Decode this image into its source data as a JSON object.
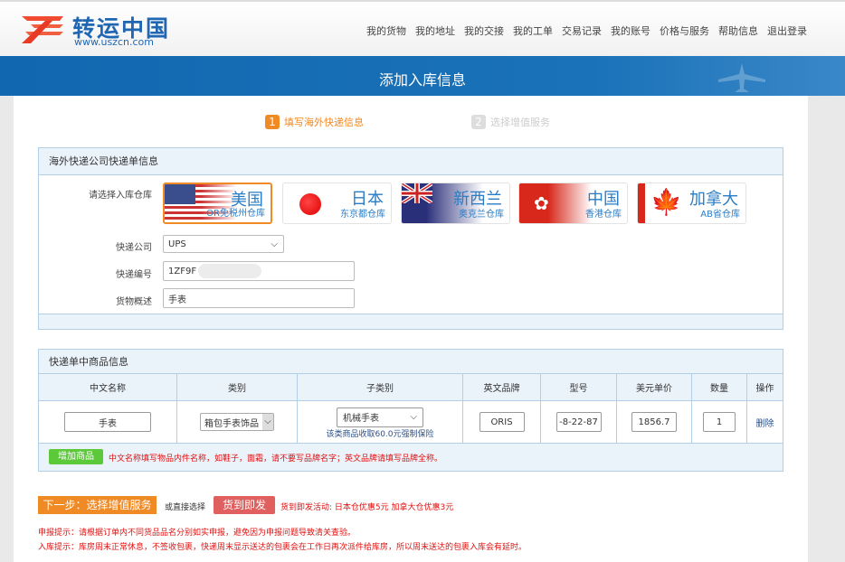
{
  "header": {
    "logo_text": "转运中国",
    "logo_url": "www.uszcn.com",
    "nav": [
      "我的货物",
      "我的地址",
      "我的交接",
      "我的工单",
      "交易记录",
      "我的账号",
      "价格与服务",
      "帮助信息",
      "退出登录"
    ]
  },
  "banner": {
    "title": "添加入库信息"
  },
  "steps": [
    {
      "num": "1",
      "label": "填写海外快递信息",
      "active": true
    },
    {
      "num": "2",
      "label": "选择增值服务",
      "active": false
    }
  ],
  "panel1": {
    "title": "海外快递公司快递单信息",
    "warehouse_label": "请选择入库仓库",
    "warehouses": [
      {
        "name": "美国",
        "sub": "OR免税州仓库",
        "selected": true,
        "flag": "us-flag-icon"
      },
      {
        "name": "日本",
        "sub": "东京都仓库",
        "selected": false,
        "flag": "japan-flag-icon"
      },
      {
        "name": "新西兰",
        "sub": "奥克兰仓库",
        "selected": false,
        "flag": "nz-flag-icon"
      },
      {
        "name": "中国",
        "sub": "香港仓库",
        "selected": false,
        "flag": "hk-flag-icon"
      },
      {
        "name": "加拿大",
        "sub": "AB省仓库",
        "selected": false,
        "flag": "canada-flag-icon"
      }
    ],
    "courier_label": "快递公司",
    "courier_value": "UPS",
    "tracking_label": "快递编号",
    "tracking_value": "1ZF9F",
    "desc_label": "货物概述",
    "desc_value": "手表"
  },
  "panel2": {
    "title": "快递单中商品信息",
    "columns": [
      "中文名称",
      "类别",
      "子类别",
      "英文品牌",
      "型号",
      "美元单价",
      "数量",
      "操作"
    ],
    "row": {
      "name": "手表",
      "category": "箱包手表饰品",
      "subcategory": "机械手表",
      "insurance_note": "该类商品收取60.0元强制保险",
      "brand": "ORIS",
      "model": "-8-22-87",
      "price": "1856.7",
      "qty": "1",
      "delete": "删除"
    },
    "add_button": "增加商品",
    "hint": "中文名称填写物品内件名称，如鞋子，面霜，请不要写品牌名字；英文品牌请填写品牌全称。"
  },
  "actions": {
    "next": "下一步：选择增值服务",
    "or_text": "或直接选择",
    "ship": "货到即发",
    "promo": "货到即发活动: 日本仓优惠5元 加拿大仓优惠3元"
  },
  "notes": [
    "申报提示：请根据订单内不同货品品名分别如实申报，避免因为申报问题导致清关查验。",
    "入库提示：库房周末正常休息，不签收包裹，快递周末显示送达的包裹会在工作日再次派件给库房，所以周末送达的包裹入库会有延时。"
  ],
  "colors": {
    "brand_blue": "#1f66b3",
    "accent_orange": "#f08a24",
    "ship_red": "#e06060",
    "add_green": "#5cc93a"
  }
}
